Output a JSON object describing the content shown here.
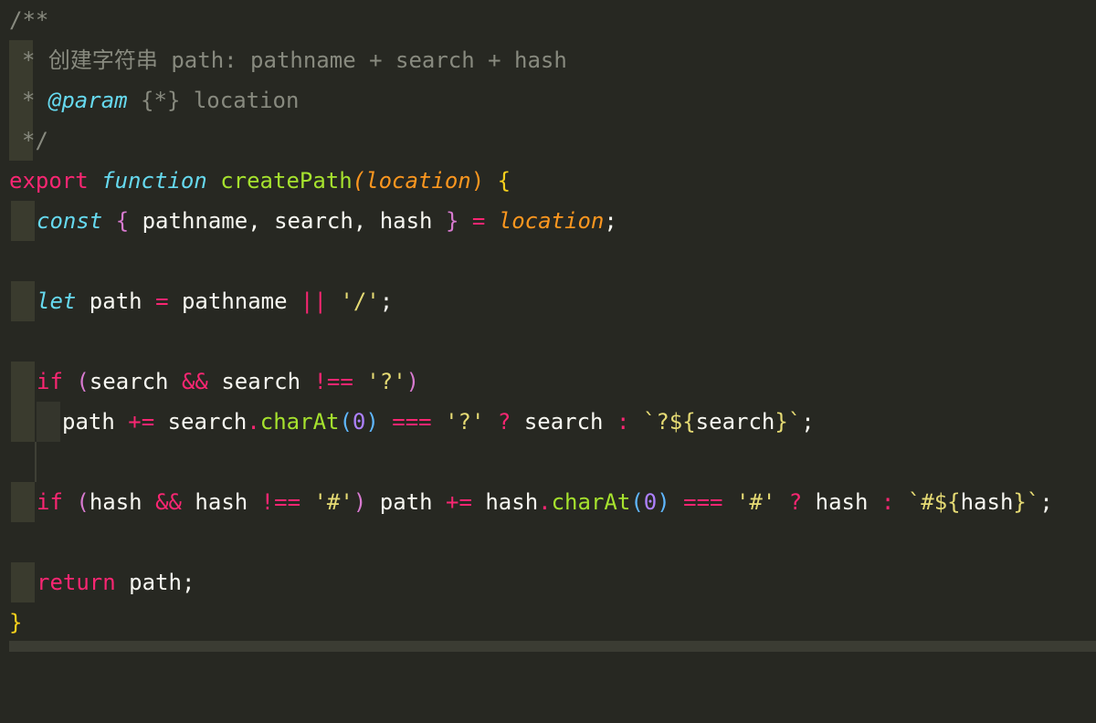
{
  "editor": {
    "comment_open": "/**",
    "comment_star1": "* ",
    "comment_desc": "创建字符串 path: pathname + search + hash",
    "comment_star2": "* ",
    "param_tag": "@param",
    "param_type": " {*} location",
    "comment_close": "*/",
    "kw_export": "export",
    "kw_function": "function",
    "fn_name": "createPath",
    "param_location": "location",
    "kw_const": "const",
    "destructure_vars": " pathname, search, hash ",
    "id_location": "location",
    "kw_let": "let",
    "let_name": " path ",
    "op_assign": "=",
    "let_rhs": " pathname ",
    "op_or": "||",
    "str_slash": "'/'",
    "kw_if": "if",
    "id_search": "search",
    "op_and": "&&",
    "op_neq": "!==",
    "str_q": "'?'",
    "id_path": "path",
    "op_pluseq": "+=",
    "method_charAt": "charAt",
    "num_zero": "0",
    "op_eqeqeq": "===",
    "op_ternary_q": "?",
    "op_ternary_colon": ":",
    "tpl_q": "`?${",
    "tpl_close": "}`",
    "id_hash": "hash",
    "str_hash": "'#'",
    "tpl_hash": "`#${",
    "kw_return": "return",
    "return_value": " path;",
    "brace_close": "}"
  }
}
